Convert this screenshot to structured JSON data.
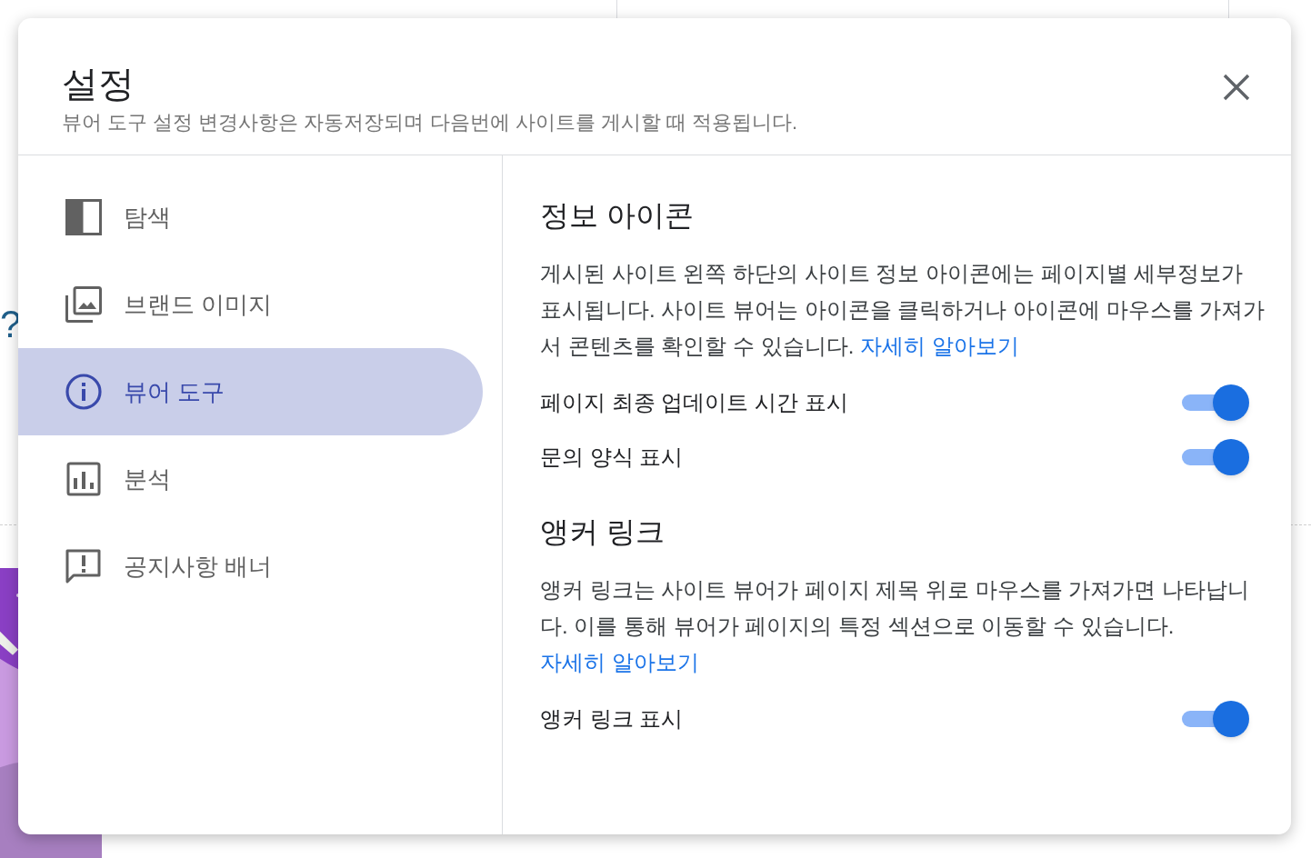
{
  "background": {
    "fragment": "?"
  },
  "dialog": {
    "title": "설정",
    "subtitle": "뷰어 도구 설정 변경사항은 자동저장되며 다음번에 사이트를 게시할 때 적용됩니다."
  },
  "sidebar": {
    "items": [
      {
        "label": "탐색",
        "kind": "panel",
        "selected": false
      },
      {
        "label": "브랜드 이미지",
        "kind": "images",
        "selected": false
      },
      {
        "label": "뷰어 도구",
        "kind": "info",
        "selected": true
      },
      {
        "label": "분석",
        "kind": "chart",
        "selected": false
      },
      {
        "label": "공지사항 배너",
        "kind": "feedback",
        "selected": false
      }
    ]
  },
  "sections": [
    {
      "heading": "정보 아이콘",
      "description": "게시된 사이트 왼쪽 하단의 사이트 정보 아이콘에는 페이지별 세부정보가 표시됩니다. 사이트 뷰어는 아이콘을 클릭하거나 아이콘에 마우스를 가져가서 콘텐츠를 확인할 수 있습니다.",
      "link": "자세히 알아보기",
      "settings": [
        {
          "label": "페이지 최종 업데이트 시간 표시",
          "on": true
        },
        {
          "label": "문의 양식 표시",
          "on": true
        }
      ]
    },
    {
      "heading": "앵커 링크",
      "description": "앵커 링크는 사이트 뷰어가 페이지 제목 위로 마우스를 가져가면 나타납니다. 이를 통해 뷰어가 페이지의 특정 섹션으로 이동할 수 있습니다.",
      "link": "자세히 알아보기",
      "settings": [
        {
          "label": "앵커 링크 표시",
          "on": true
        }
      ]
    }
  ]
}
